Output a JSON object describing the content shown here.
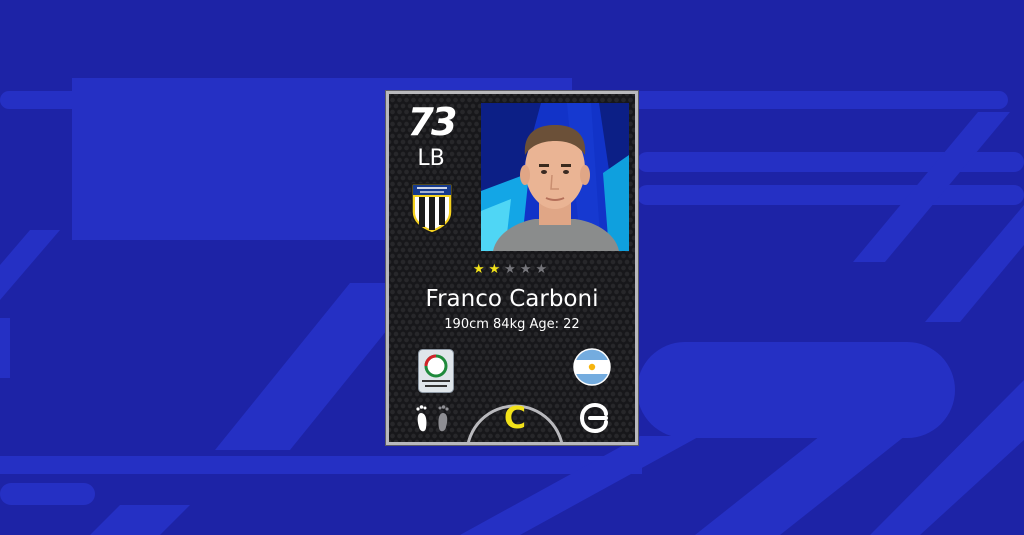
{
  "colors": {
    "background": "#1d23a6",
    "background_stripes": "#2530c4",
    "card_frame": "#b9b9bd",
    "star_active": "#f2e21a",
    "star_inactive": "#77777c",
    "grade": "#f2e21a"
  },
  "player": {
    "overall_rating": "73",
    "position": "LB",
    "name": "Franco Carboni",
    "details": "190cm 84kg Age: 22",
    "stars_filled": 2,
    "stars_total": 5,
    "card_grade": "C",
    "club_badge_text": "PARMA CALCIO",
    "league_badge_text": "CAMPIONATO ITALIANO",
    "nationality_flag": "argentina-flag-icon"
  },
  "icons": {
    "club": "parma-calcio-badge-icon",
    "league": "serie-a-league-icon",
    "flag": "argentina-flag-icon",
    "foot": "footprints-icon",
    "brand": "efootball-logo-icon"
  }
}
